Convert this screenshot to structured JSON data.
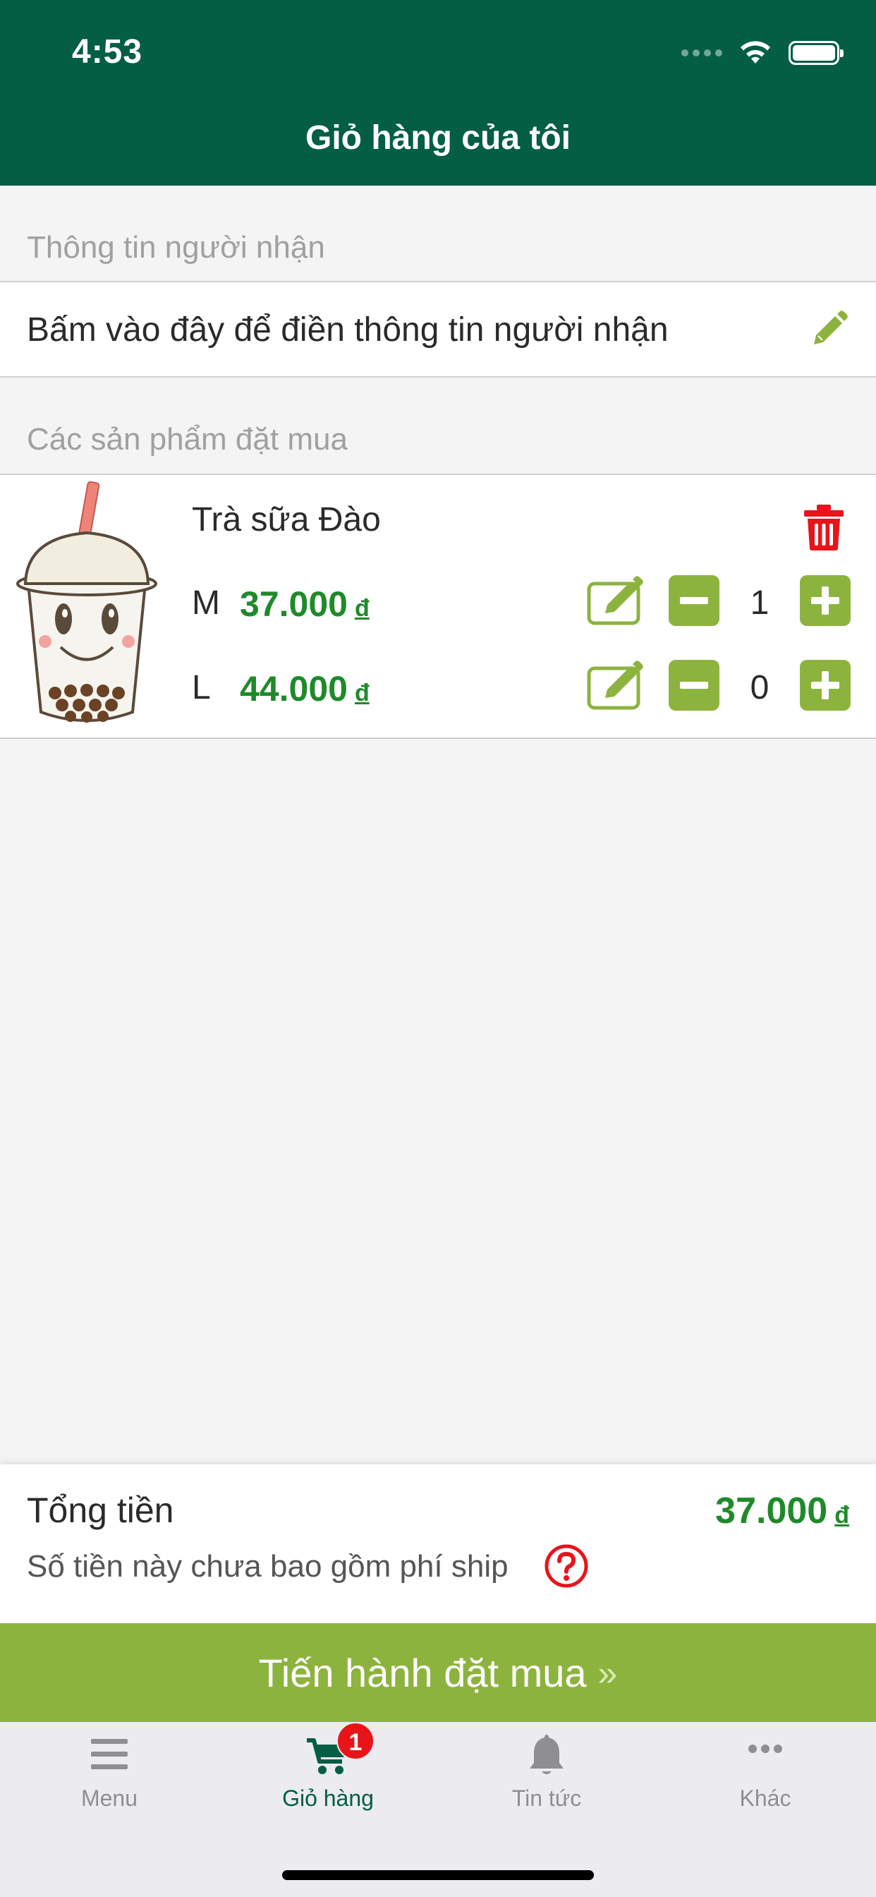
{
  "status_bar": {
    "time": "4:53"
  },
  "header": {
    "title": "Giỏ hàng của tôi"
  },
  "recipient": {
    "section_label": "Thông tin người nhận",
    "prompt": "Bấm vào đây để điền thông tin người nhận",
    "edit_icon": "pencil-icon"
  },
  "products": {
    "section_label": "Các sản phẩm đặt mua",
    "items": [
      {
        "name": "Trà sữa Đào",
        "image_icon": "bubble-tea-cup",
        "sizes": [
          {
            "size": "M",
            "price": "37.000",
            "currency": "đ",
            "quantity": "1"
          },
          {
            "size": "L",
            "price": "44.000",
            "currency": "đ",
            "quantity": "0"
          }
        ]
      }
    ]
  },
  "summary": {
    "total_label": "Tổng tiền",
    "total_value": "37.000",
    "currency": "đ",
    "ship_note": "Số tiền này chưa bao gồm phí ship"
  },
  "checkout": {
    "label": "Tiến hành đặt mua",
    "arrow": "»"
  },
  "tabbar": {
    "tabs": [
      {
        "label": "Menu",
        "icon": "menu-icon"
      },
      {
        "label": "Giỏ hàng",
        "icon": "cart-icon",
        "badge": "1",
        "active": true
      },
      {
        "label": "Tin tức",
        "icon": "bell-icon"
      },
      {
        "label": "Khác",
        "icon": "more-icon"
      }
    ]
  },
  "colors": {
    "header_bg": "#035e43",
    "accent_green": "#8db33f",
    "price_green": "#1f8a2a",
    "danger_red": "#e8141a"
  }
}
